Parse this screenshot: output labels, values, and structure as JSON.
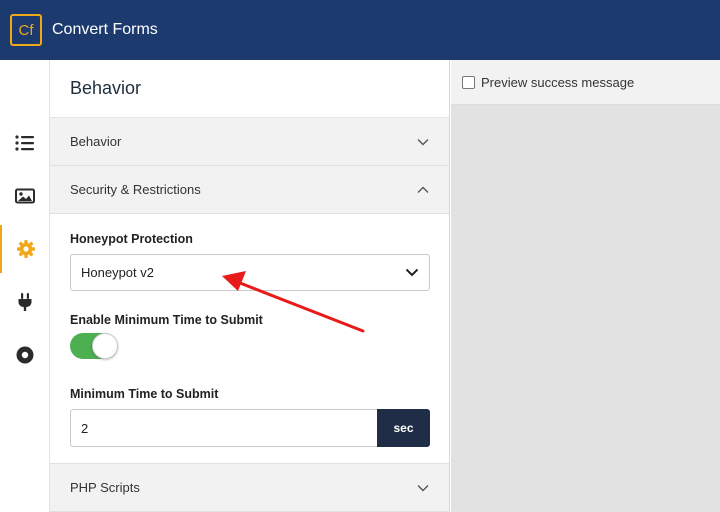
{
  "app": {
    "logo_text": "Cf",
    "title": "Convert Forms"
  },
  "sidebar": {
    "items": [
      {
        "icon": "list-icon",
        "active": false
      },
      {
        "icon": "image-icon",
        "active": false
      },
      {
        "icon": "gear-icon",
        "active": true
      },
      {
        "icon": "plug-icon",
        "active": false
      },
      {
        "icon": "record-icon",
        "active": false
      }
    ]
  },
  "panel": {
    "title": "Behavior",
    "sections": {
      "behavior": {
        "label": "Behavior",
        "expanded": false
      },
      "security": {
        "label": "Security & Restrictions",
        "expanded": true
      },
      "php": {
        "label": "PHP Scripts",
        "expanded": false
      }
    },
    "honeypot": {
      "label": "Honeypot Protection",
      "value": "Honeypot v2"
    },
    "min_time_toggle": {
      "label": "Enable Minimum Time to Submit",
      "enabled": true
    },
    "min_time": {
      "label": "Minimum Time to Submit",
      "value": "2",
      "unit": "sec"
    }
  },
  "preview": {
    "checkbox_label": "Preview success message",
    "checked": false
  },
  "colors": {
    "topbar": "#1c3a6e",
    "accent": "#f0a818",
    "toggle_on": "#4caf50",
    "annotation_arrow": "#e81a1a"
  }
}
